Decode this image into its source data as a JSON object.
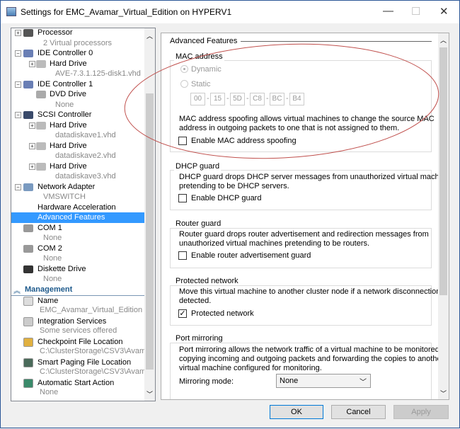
{
  "window": {
    "title": "Settings for EMC_Avamar_Virtual_Edition on HYPERV1",
    "minimize": "—",
    "maximize": "☐",
    "close": "✕"
  },
  "tree": {
    "items": [
      {
        "label": "Processor",
        "sub": "2 Virtual processors",
        "icon": "processor-icon",
        "expander": "+"
      },
      {
        "label": "IDE Controller 0",
        "icon": "ide-controller-icon",
        "expander": "−"
      },
      {
        "label": "Hard Drive",
        "sub": "AVE-7.3.1.125-disk1.vhd",
        "icon": "hard-drive-icon",
        "expander": "+"
      },
      {
        "label": "IDE Controller 1",
        "icon": "ide-controller-icon",
        "expander": "−"
      },
      {
        "label": "DVD Drive",
        "sub": "None",
        "icon": "dvd-drive-icon"
      },
      {
        "label": "SCSI Controller",
        "icon": "scsi-controller-icon",
        "expander": "−"
      },
      {
        "label": "Hard Drive",
        "sub": "datadiskave1.vhd",
        "icon": "hard-drive-icon",
        "expander": "+"
      },
      {
        "label": "Hard Drive",
        "sub": "datadiskave2.vhd",
        "icon": "hard-drive-icon",
        "expander": "+"
      },
      {
        "label": "Hard Drive",
        "sub": "datadiskave3.vhd",
        "icon": "hard-drive-icon",
        "expander": "+"
      },
      {
        "label": "Network Adapter",
        "sub": "VMSWITCH",
        "icon": "network-adapter-icon",
        "expander": "−"
      },
      {
        "label": "Hardware Acceleration"
      },
      {
        "label": "Advanced Features",
        "selected": true
      },
      {
        "label": "COM 1",
        "sub": "None",
        "icon": "com-port-icon"
      },
      {
        "label": "COM 2",
        "sub": "None",
        "icon": "com-port-icon"
      },
      {
        "label": "Diskette Drive",
        "sub": "None",
        "icon": "diskette-icon"
      }
    ],
    "management_header": "Management",
    "management": [
      {
        "label": "Name",
        "sub": "EMC_Avamar_Virtual_Edition",
        "icon": "name-icon"
      },
      {
        "label": "Integration Services",
        "sub": "Some services offered",
        "icon": "integration-services-icon"
      },
      {
        "label": "Checkpoint File Location",
        "sub": "C:\\ClusterStorage\\CSV3\\Avamar\\",
        "icon": "checkpoint-folder-icon"
      },
      {
        "label": "Smart Paging File Location",
        "sub": "C:\\ClusterStorage\\CSV3\\Avamar\\",
        "icon": "smart-paging-icon"
      },
      {
        "label": "Automatic Start Action",
        "sub": "None",
        "icon": "start-action-icon"
      }
    ]
  },
  "panel": {
    "title": "Advanced Features",
    "mac": {
      "label": "MAC address",
      "dynamic": "Dynamic",
      "static": "Static",
      "selected": "Dynamic",
      "octets": [
        "00",
        "15",
        "5D",
        "C8",
        "BC",
        "B4"
      ],
      "desc1": "MAC address spoofing allows virtual machines to change the source MAC",
      "desc2": "address in outgoing packets to one that is not assigned to them.",
      "checkbox": "Enable MAC address spoofing",
      "checked": false
    },
    "dhcp": {
      "label": "DHCP guard",
      "desc1": "DHCP guard drops DHCP server messages from unauthorized virtual machines",
      "desc2": "pretending to be DHCP servers.",
      "checkbox": "Enable DHCP guard",
      "checked": false
    },
    "router": {
      "label": "Router guard",
      "desc1": "Router guard drops router advertisement and redirection messages from",
      "desc2": "unauthorized virtual machines pretending to be routers.",
      "checkbox": "Enable router advertisement guard",
      "checked": false
    },
    "protected": {
      "label": "Protected network",
      "desc1": "Move this virtual machine to another cluster node if a network disconnection is",
      "desc2": "detected.",
      "checkbox": "Protected network",
      "checked": true
    },
    "mirror": {
      "label": "Port mirroring",
      "desc1": "Port mirroring allows the network traffic of a virtual machine to be monitored by",
      "desc2": "copying incoming and outgoing packets and forwarding the copies to another",
      "desc3": "virtual machine configured for monitoring.",
      "mode_label": "Mirroring mode:",
      "mode_value": "None"
    }
  },
  "buttons": {
    "ok": "OK",
    "cancel": "Cancel",
    "apply": "Apply"
  },
  "colors": {
    "selection": "#3399ff",
    "annotation": "#c0504d",
    "header": "#1e5a8c"
  }
}
